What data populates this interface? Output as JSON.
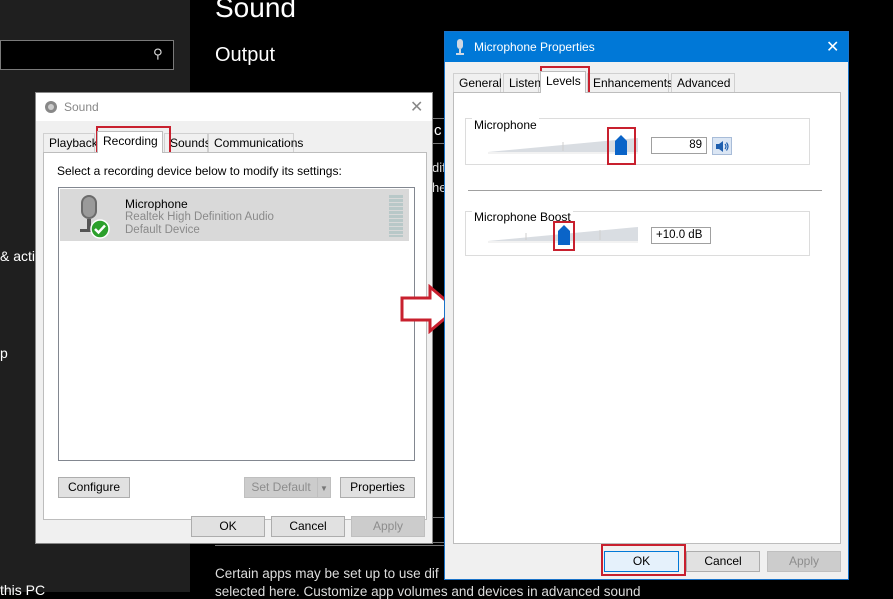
{
  "settings": {
    "title": "Sound",
    "output_heading": "Output",
    "nav_fragment_1": "& acti",
    "nav_fragment_2": "p",
    "nav_fragment_3": "this PC",
    "body_line_1": "Certain apps may be set up to use dif",
    "body_line_2": "selected here. Customize app volumes and devices in advanced sound",
    "text_fragment_c": "c",
    "text_fragment_dif": "dif",
    "text_fragment_he": "he"
  },
  "sound_dialog": {
    "title": "Sound",
    "tabs": [
      "Playback",
      "Recording",
      "Sounds",
      "Communications"
    ],
    "instruction": "Select a recording device below to modify its settings:",
    "device": {
      "name": "Microphone",
      "driver": "Realtek High Definition Audio",
      "status": "Default Device"
    },
    "buttons": {
      "configure": "Configure",
      "set_default": "Set Default",
      "properties": "Properties",
      "ok": "OK",
      "cancel": "Cancel",
      "apply": "Apply"
    }
  },
  "mic_properties": {
    "title": "Microphone Properties",
    "tabs": [
      "General",
      "Listen",
      "Levels",
      "Enhancements",
      "Advanced"
    ],
    "microphone_label": "Microphone",
    "microphone_level": "89",
    "boost_label": "Microphone Boost",
    "boost_value": "+10.0 dB",
    "buttons": {
      "ok": "OK",
      "cancel": "Cancel",
      "apply": "Apply"
    }
  },
  "colors": {
    "highlight_red": "#c8202e",
    "title_bar_blue": "#0078d7",
    "thumb_blue": "#0a64c8"
  }
}
